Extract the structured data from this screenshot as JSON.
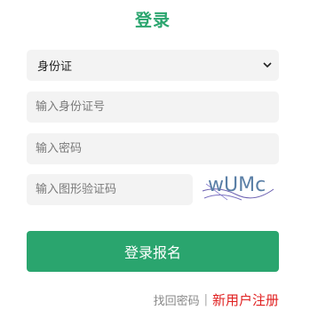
{
  "title": "登录",
  "id_type": {
    "selected": "身份证"
  },
  "id_number": {
    "placeholder": "输入身份证号"
  },
  "password": {
    "placeholder": "输入密码"
  },
  "captcha_input": {
    "placeholder": "输入图形验证码"
  },
  "captcha_image": {
    "text": "wUMc"
  },
  "submit": {
    "label": "登录报名"
  },
  "links": {
    "forgot_password": "找回密码",
    "separator": "|",
    "register": "新用户注册"
  },
  "colors": {
    "accent": "#2aa56e",
    "register_link": "#e02020",
    "field_bg": "#f3f3f3"
  }
}
